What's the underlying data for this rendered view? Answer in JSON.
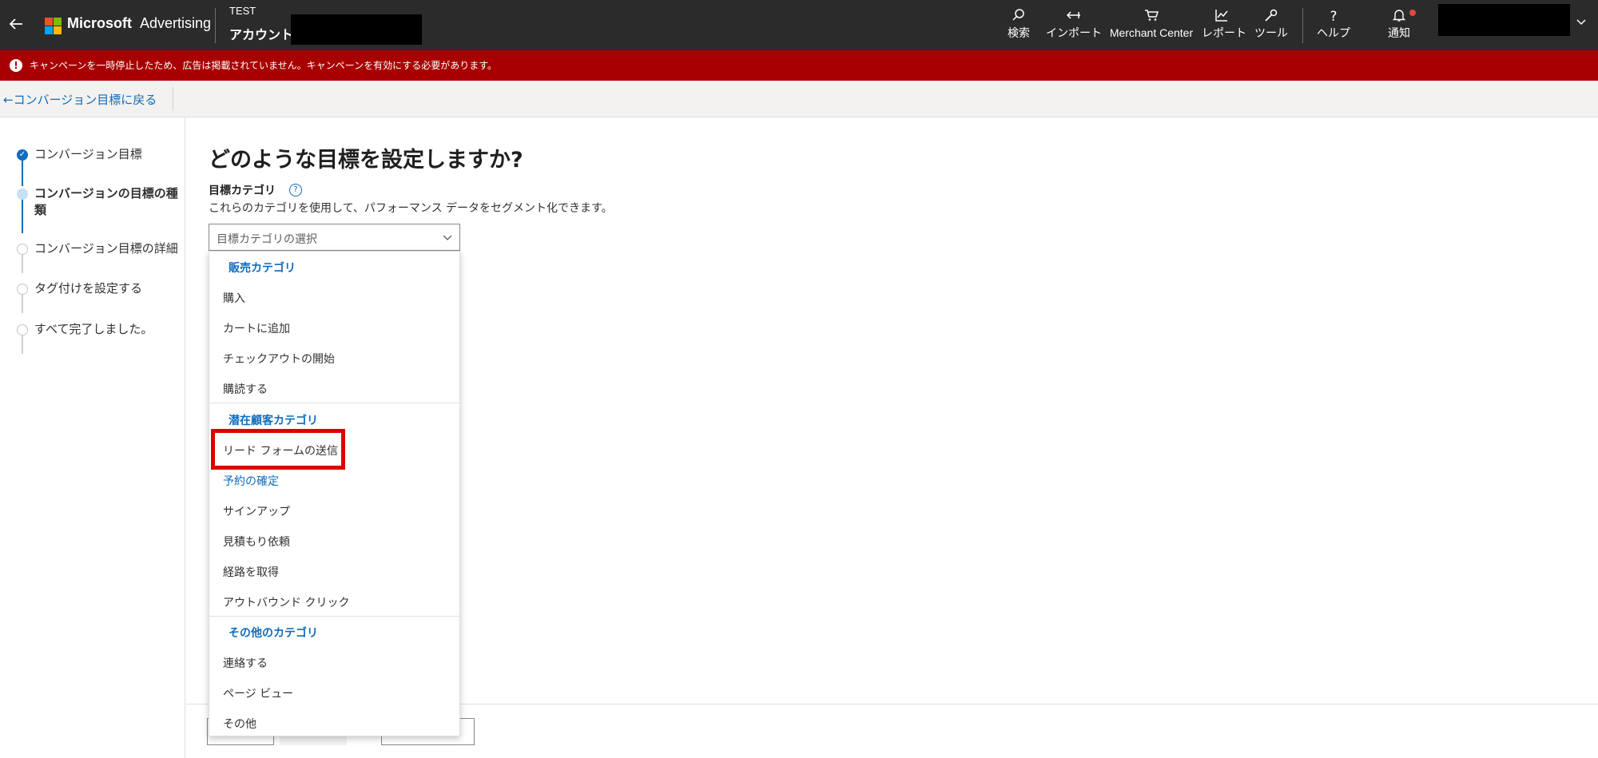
{
  "topbar": {
    "brand_name": "Microsoft",
    "brand_product": "Advertising",
    "account_label_small": "TEST",
    "account_label": "アカウント",
    "nav": [
      {
        "icon": "search-icon",
        "label": "検索"
      },
      {
        "icon": "import-icon",
        "label": "インポート"
      },
      {
        "icon": "cart-icon",
        "label": "Merchant Center"
      },
      {
        "icon": "chart-icon",
        "label": "レポート"
      },
      {
        "icon": "wrench-icon",
        "label": "ツール"
      },
      {
        "icon": "help-icon",
        "label": "ヘルプ"
      },
      {
        "icon": "bell-icon",
        "label": "通知"
      }
    ],
    "logo_colors": [
      "#f25022",
      "#7fba00",
      "#00a4ef",
      "#ffb900"
    ]
  },
  "alert": {
    "text": "キャンペーンを一時停止したため、広告は掲載されていません。キャンペーンを有効にする必要があります。",
    "color": "#a80000"
  },
  "breadcrumb": {
    "back_label": "←コンバージョン目標に戻る"
  },
  "steps": [
    {
      "label": "コンバージョン目標",
      "state": "done"
    },
    {
      "label": "コンバージョンの目標の種類",
      "state": "current"
    },
    {
      "label": "コンバージョン目標の詳細",
      "state": "pending"
    },
    {
      "label": "タグ付けを設定する",
      "state": "pending"
    },
    {
      "label": "すべて完了しました。",
      "state": "pending"
    }
  ],
  "main": {
    "title": "どのような目標を設定しますか?",
    "field_label": "目標カテゴリ",
    "field_desc": "これらのカテゴリを使用して、パフォーマンス データをセグメント化できます。",
    "select_placeholder": "目標カテゴリの選択"
  },
  "dropdown": {
    "groups": [
      {
        "header": "販売カテゴリ",
        "items": [
          "購入",
          "カートに追加",
          "チェックアウトの開始",
          "購読する"
        ]
      },
      {
        "header": "潜在顧客カテゴリ",
        "items": [
          "リード フォームの送信",
          "予約の確定",
          "サインアップ",
          "見積もり依頼",
          "経路を取得",
          "アウトバウンド クリック"
        ]
      },
      {
        "header": "その他のカテゴリ",
        "items": [
          "連絡する",
          "ページ ビュー",
          "その他"
        ]
      }
    ],
    "highlighted_item": "リード フォームの送信",
    "hovered_item": "予約の確定"
  },
  "colors": {
    "accent": "#0f6cbd",
    "topbar": "#2b2b2b",
    "highlight_box": "#e00000"
  }
}
